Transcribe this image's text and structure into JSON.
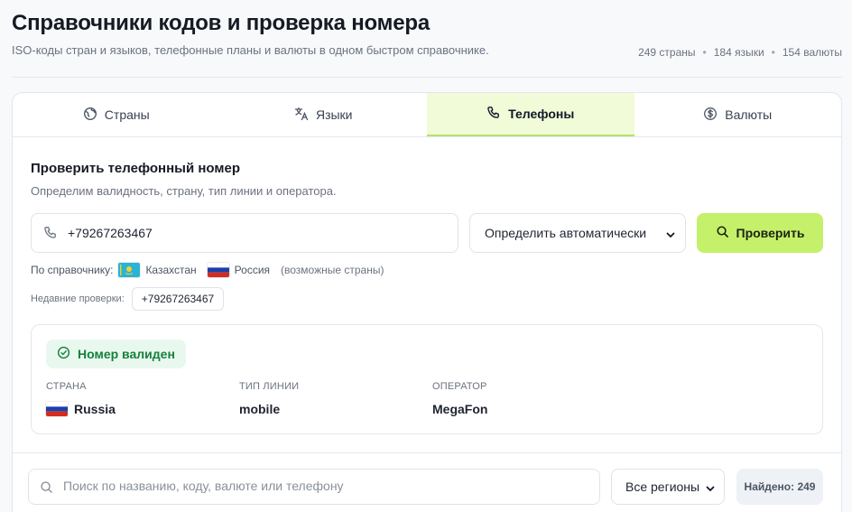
{
  "header": {
    "title": "Справочники кодов и проверка номера",
    "subtitle": "ISO-коды стран и языков, телефонные планы и валюты в одном быстром справочнике.",
    "stats": [
      "249 страны",
      "184 языки",
      "154 валюты"
    ]
  },
  "tabs": [
    {
      "label": "Страны",
      "icon": "globe-icon"
    },
    {
      "label": "Языки",
      "icon": "translate-icon"
    },
    {
      "label": "Телефоны",
      "icon": "phone-icon",
      "active": true
    },
    {
      "label": "Валюты",
      "icon": "dollar-icon"
    }
  ],
  "phone_check": {
    "title": "Проверить телефонный номер",
    "description": "Определим валидность, страну, тип линии и оператора.",
    "phone_value": "+79267263467",
    "country_select": "Определить автоматически",
    "check_button": "Проверить",
    "hint_label": "По справочнику:",
    "hint_countries": [
      "Казахстан",
      "Россия"
    ],
    "hint_note": "(возможные страны)",
    "recent_label": "Недавние проверки:",
    "recent_items": [
      "+79267263467"
    ]
  },
  "result": {
    "status": "Номер валиден",
    "fields": [
      {
        "label": "Страна",
        "value": "Russia"
      },
      {
        "label": "Тип линии",
        "value": "mobile"
      },
      {
        "label": "Оператор",
        "value": "MegaFon"
      }
    ]
  },
  "search": {
    "placeholder": "Поиск по названию, коду, валюте или телефону",
    "region_select": "Все регионы",
    "found": "Найдено: 249"
  },
  "colors": {
    "accent": "#c5f06a",
    "active_tab_bg": "#f1fbd8",
    "valid_green": "#15803d",
    "valid_bg": "#e9f8ee"
  }
}
